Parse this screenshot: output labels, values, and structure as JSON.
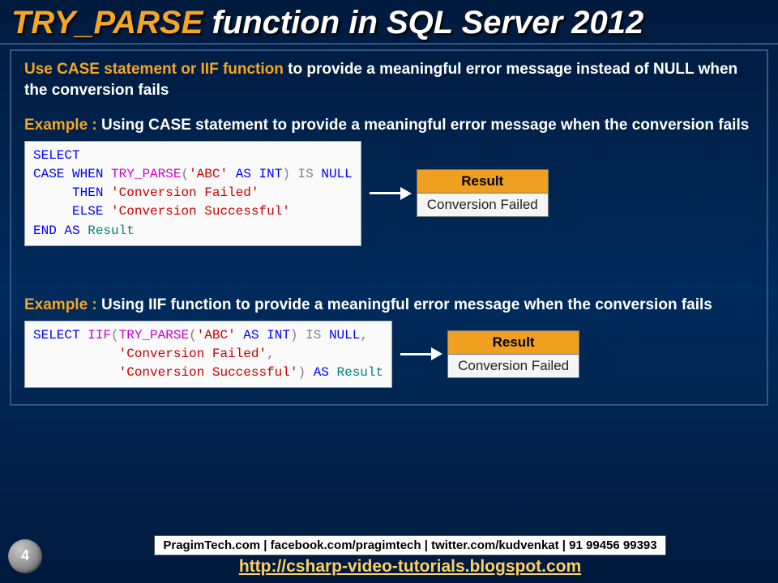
{
  "title": {
    "hl": "TRY_PARSE ",
    "rest": "function in SQL Server 2012"
  },
  "intro": {
    "hl": "Use CASE statement or IIF function ",
    "rest": "to provide a meaningful error message instead of NULL when the conversion fails"
  },
  "example1": {
    "label_hl": "Example : ",
    "label_rest": "Using CASE statement to provide a meaningful error message when the conversion fails",
    "result_header": "Result",
    "result_value": "Conversion Failed"
  },
  "example2": {
    "label_hl": "Example : ",
    "label_rest": "Using IIF function to provide a meaningful error message when the conversion fails",
    "result_header": "Result",
    "result_value": "Conversion Failed"
  },
  "footer": {
    "page": "4",
    "credits": "PragimTech.com | facebook.com/pragimtech | twitter.com/kudvenkat | 91 99456 99393",
    "blog": "http://csharp-video-tutorials.blogspot.com"
  }
}
